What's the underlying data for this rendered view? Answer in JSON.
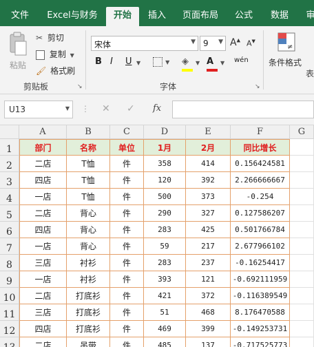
{
  "tabs": [
    "文件",
    "Excel与财务",
    "开始",
    "插入",
    "页面布局",
    "公式",
    "数据",
    "审"
  ],
  "active_tab": "开始",
  "clipboard": {
    "paste": "粘贴",
    "cut": "剪切",
    "copy": "复制",
    "format_painter": "格式刷",
    "group": "剪贴板"
  },
  "font": {
    "name": "宋体",
    "size": "9",
    "grow": "A",
    "shrink": "A",
    "bold": "B",
    "italic": "I",
    "underline": "U",
    "phonetic": "wén",
    "group": "字体"
  },
  "styles": {
    "cond_format": "条件格式",
    "table": "表"
  },
  "formula_bar": {
    "name_box": "U13",
    "cancel": "✕",
    "enter": "✓",
    "fx": "fx",
    "value": ""
  },
  "columns": [
    "A",
    "B",
    "C",
    "D",
    "E",
    "F",
    "G"
  ],
  "rows": [
    "1",
    "2",
    "3",
    "4",
    "5",
    "6",
    "7",
    "8",
    "9",
    "10",
    "11",
    "12",
    "13"
  ],
  "table": {
    "headers": [
      "部门",
      "名称",
      "单位",
      "1月",
      "2月",
      "同比增长"
    ],
    "data": [
      [
        "二店",
        "T恤",
        "件",
        "358",
        "414",
        "0.156424581"
      ],
      [
        "四店",
        "T恤",
        "件",
        "120",
        "392",
        "2.266666667"
      ],
      [
        "一店",
        "T恤",
        "件",
        "500",
        "373",
        "-0.254"
      ],
      [
        "二店",
        "背心",
        "件",
        "290",
        "327",
        "0.127586207"
      ],
      [
        "四店",
        "背心",
        "件",
        "283",
        "425",
        "0.501766784"
      ],
      [
        "一店",
        "背心",
        "件",
        "59",
        "217",
        "2.677966102"
      ],
      [
        "三店",
        "衬衫",
        "件",
        "283",
        "237",
        "-0.16254417"
      ],
      [
        "一店",
        "衬衫",
        "件",
        "393",
        "121",
        "-0.692111959"
      ],
      [
        "二店",
        "打底衫",
        "件",
        "421",
        "372",
        "-0.116389549"
      ],
      [
        "三店",
        "打底衫",
        "件",
        "51",
        "468",
        "8.176470588"
      ],
      [
        "四店",
        "打底衫",
        "件",
        "469",
        "399",
        "-0.149253731"
      ],
      [
        "二店",
        "吊带",
        "件",
        "485",
        "137",
        "-0.717525773"
      ]
    ]
  },
  "colors": {
    "excel_green": "#217346",
    "header_fill": "#e2efda",
    "header_text": "#e02020",
    "border": "#e4a06a"
  }
}
